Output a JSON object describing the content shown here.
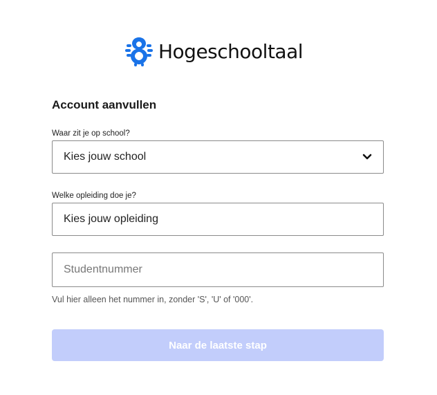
{
  "brand": {
    "name": "Hogeschooltaal",
    "logo_icon": "hogeschooltaal-logo-icon",
    "accent_color": "#1a73e8"
  },
  "form": {
    "title": "Account aanvullen",
    "school": {
      "label": "Waar zit je op school?",
      "value": "Kies jouw school",
      "icon": "chevron-down-icon"
    },
    "education": {
      "label": "Welke opleiding doe je?",
      "value": "Kies jouw opleiding"
    },
    "student_number": {
      "placeholder": "Studentnummer",
      "hint": "Vul hier alleen het nummer in, zonder 'S', 'U' of '000'."
    },
    "submit": {
      "label": "Naar de laatste stap",
      "state": "disabled",
      "color": "#c2cdfb"
    }
  }
}
